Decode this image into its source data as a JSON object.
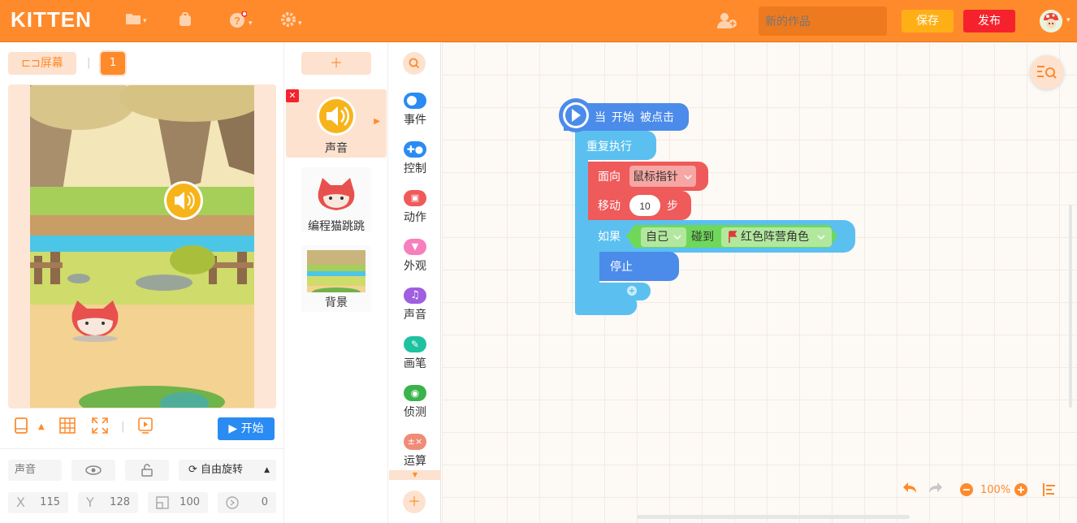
{
  "header": {
    "logo": "KITTEN",
    "project_placeholder": "新的作品",
    "save": "保存",
    "publish": "发布"
  },
  "stage": {
    "screen_button": "屏幕",
    "screen_number": "1",
    "start_button": "开始"
  },
  "props": {
    "name": "声音",
    "rotation": "自由旋转",
    "x_label": "X",
    "x": "115",
    "y_label": "Y",
    "y": "128",
    "size": "100",
    "direction": "0"
  },
  "sprites": [
    {
      "label": "声音"
    },
    {
      "label": "编程猫跳跳"
    },
    {
      "label": "背景"
    }
  ],
  "categories": [
    {
      "label": "事件",
      "color": "#2a8bf2"
    },
    {
      "label": "控制",
      "color": "#2a8bf2"
    },
    {
      "label": "动作",
      "color": "#ef5a5a"
    },
    {
      "label": "外观",
      "color": "#f77fbe"
    },
    {
      "label": "声音",
      "color": "#a05ee0"
    },
    {
      "label": "画笔",
      "color": "#1fc2a0"
    },
    {
      "label": "侦测",
      "color": "#3bb34a"
    },
    {
      "label": "运算",
      "color": "#ef8c78"
    }
  ],
  "blocks": {
    "when": "当",
    "start": "开始",
    "clicked": "被点击",
    "repeat": "重复执行",
    "face": "面向",
    "face_target": "鼠标指针",
    "move": "移动",
    "move_steps": "10",
    "steps": "步",
    "if": "如果",
    "self": "自己",
    "touch": "碰到",
    "target": "红色阵营角色",
    "stop": "停止"
  },
  "workspace": {
    "zoom": "100%"
  }
}
